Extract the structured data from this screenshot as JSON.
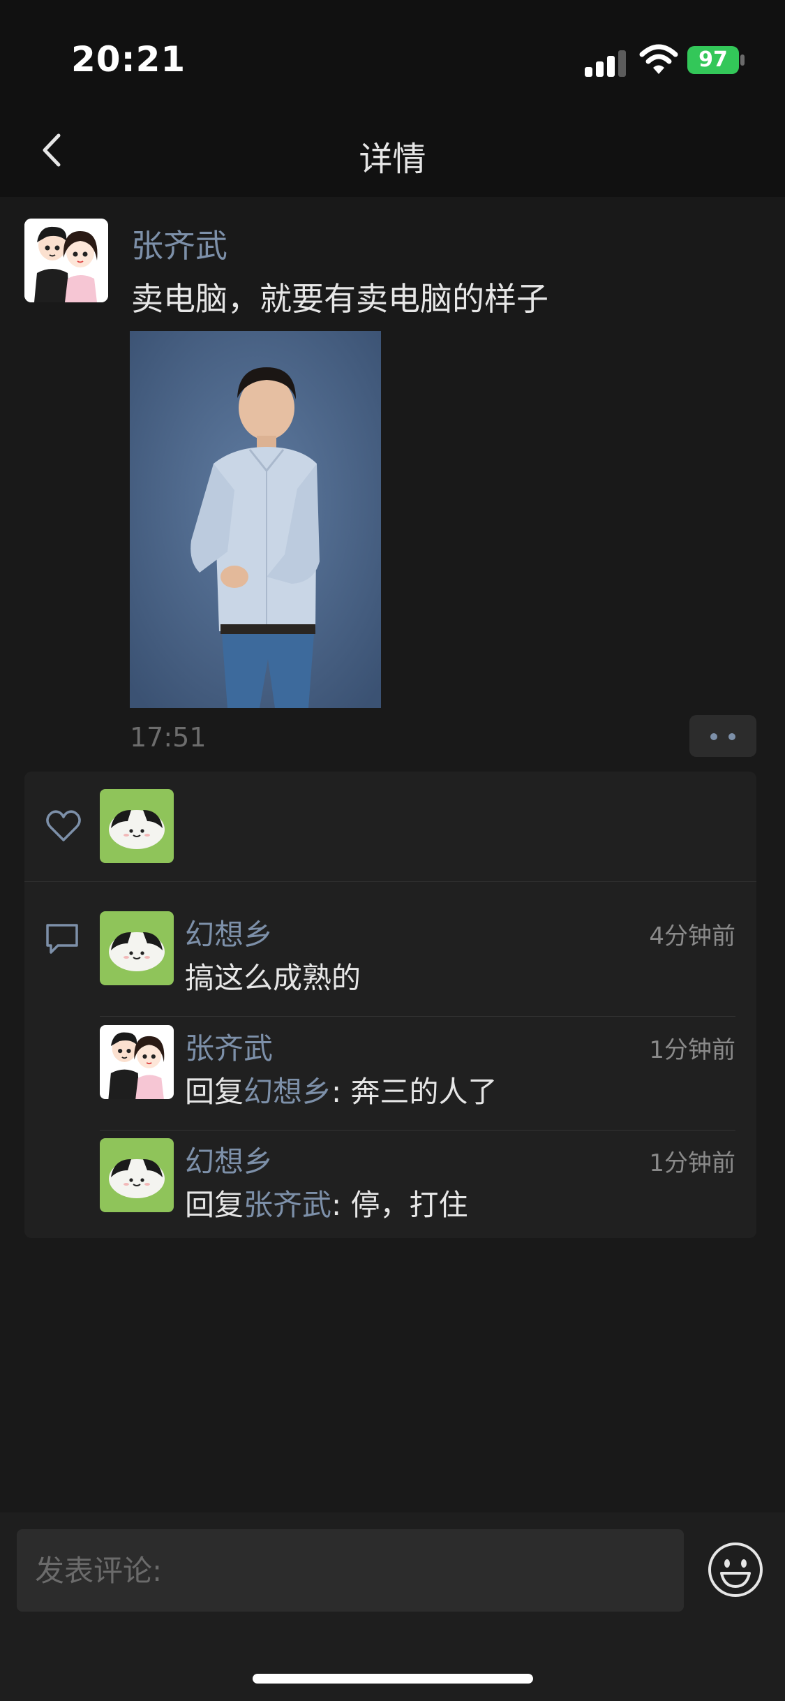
{
  "status_bar": {
    "time": "20:21",
    "battery": "97"
  },
  "nav": {
    "title": "详情",
    "back_icon": "chevron-left-icon"
  },
  "post": {
    "author": "张齐武",
    "text": "卖电脑，就要有卖电脑的样子",
    "time": "17:51",
    "more_icon": "ellipsis-icon"
  },
  "likes": {
    "icon": "heart-icon"
  },
  "comments": [
    {
      "name": "幻想乡",
      "time": "4分钟前",
      "text": "搞这么成熟的"
    },
    {
      "name": "张齐武",
      "time": "1分钟前",
      "reply_prefix": "回复",
      "reply_to": "幻想乡",
      "reply_sep": ": ",
      "text": "奔三的人了"
    },
    {
      "name": "幻想乡",
      "time": "1分钟前",
      "reply_prefix": "回复",
      "reply_to": "张齐武",
      "reply_sep": ": ",
      "text": "停，打住"
    }
  ],
  "composer": {
    "placeholder": "发表评论:",
    "emoji_icon": "smiley-icon"
  },
  "colors": {
    "background": "#191919",
    "panel": "#202020",
    "link": "#7d90a9",
    "battery": "#33c759",
    "avatar_green": "#8fc45a"
  }
}
